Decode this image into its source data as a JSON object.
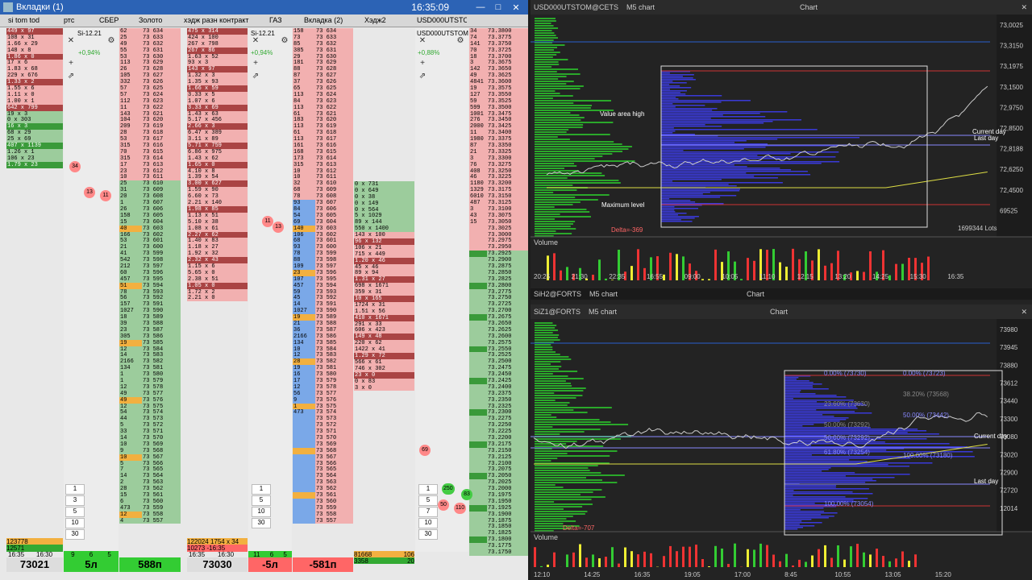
{
  "window": {
    "title": "Вкладки (1)",
    "clock": "16:35:09",
    "buttons": [
      "—",
      "□",
      "✕"
    ]
  },
  "tabs": [
    "si tom tod",
    "ртс",
    "СБЕР",
    "Золото",
    "хэдж разн контракт",
    "ГАЗ",
    "Вкладка (2)",
    "Хэдж2",
    "USD000UTSTOM"
  ],
  "ladders": {
    "col1_sizes": [
      "449 x 97",
      "108 x 31",
      "1.66 x 29",
      "148 x 8",
      "1.86 x 0",
      "17 x 6",
      "1.83 x 68",
      "229 x 676",
      "1.33 x 2",
      "1.55 x 6",
      "1.11 x 0",
      "1.00 x 1",
      "642 x 799",
      "19 x 3",
      "0 x 303",
      "16 x 3",
      "68 x 29",
      "25 x 69",
      "407 x 1139",
      "1.26 x 1",
      "106 x 23",
      "1.79 x 23"
    ],
    "col2_prices": [
      "73 634",
      "73 633",
      "73 632",
      "73 631",
      "73 630",
      "73 629",
      "73 628",
      "73 627",
      "73 626",
      "73 625",
      "73 624",
      "73 623",
      "73 622",
      "73 621",
      "73 620",
      "73 619",
      "73 618",
      "73 617",
      "73 616",
      "73 615",
      "73 614",
      "73 613",
      "73 612",
      "73 611",
      "73 610",
      "73 609",
      "73 608",
      "73 607",
      "73 606",
      "73 605",
      "73 604",
      "73 603",
      "73 602",
      "73 601",
      "73 600",
      "73 599",
      "73 598",
      "73 597",
      "73 596",
      "73 595",
      "73 594",
      "73 593",
      "73 592",
      "73 591",
      "73 590",
      "73 589",
      "73 588",
      "73 587",
      "73 586",
      "73 585",
      "73 584",
      "73 583",
      "73 582",
      "73 581",
      "73 580",
      "73 579",
      "73 578",
      "73 577",
      "73 576",
      "73 575",
      "73 574",
      "73 573",
      "73 572",
      "73 571",
      "73 570",
      "73 569",
      "73 568",
      "73 567",
      "73 566",
      "73 565",
      "73 564",
      "73 563",
      "73 562",
      "73 561",
      "73 560",
      "73 559",
      "73 558",
      "73 557"
    ],
    "col2_sizes": [
      "62",
      "25",
      "49",
      "55",
      "53",
      "113",
      "26",
      "105",
      "332",
      "57",
      "57",
      "112",
      "11",
      "143",
      "104",
      "209",
      "28",
      "53",
      "315",
      "70",
      "315",
      "17",
      "23",
      "10",
      "25",
      "31",
      "20",
      "1",
      "26",
      "158",
      "15",
      "40",
      "166",
      "53",
      "21",
      "41",
      "542",
      "212",
      "60",
      "457",
      "51",
      "78",
      "56",
      "157",
      "1027",
      "18",
      "39",
      "23",
      "305",
      "19",
      "12",
      "14",
      "2166",
      "134",
      "1",
      "1",
      "12",
      "49",
      "49",
      "12",
      "54",
      "44",
      "5",
      "33",
      "14",
      "10",
      "9",
      "10",
      "5",
      "7",
      "14",
      "2",
      "28",
      "15",
      "6",
      "473",
      "12",
      "4"
    ],
    "col3_sizes": [
      "475 x 314",
      "424 x 100",
      "267 x 798",
      "267 x 86",
      "1.63 x 52",
      "93 x 3",
      "143 x 97",
      "1.32 x 3",
      "1.35 x 93",
      "1.66 x 59",
      "3.33 x 5",
      "1.07 x 6",
      "3.33 x 69",
      "1.43 x 63",
      "5.17 x 456",
      "2.66 x 3",
      "6.47 x 389",
      "3.11 x 89",
      "5.71 x 759",
      "6.86 x 975",
      "1.43 x 62",
      "1.65 x 0",
      "4.10 x 8",
      "1.39 x 54",
      "3.00 x 627",
      "1.59 x 90",
      "6.60 x 73",
      "2.21 x 140",
      "1.98 x 85",
      "1.13 x 51",
      "5.10 x 38",
      "1.08 x 61",
      "2.27 x 62",
      "1.40 x 83",
      "1.18 x 27",
      "1.92 x 32",
      "2.32 x 43",
      "1.15 x 6",
      "5.65 x 0",
      "2.38 x 51",
      "1.05 x 0",
      "1.72 x 2",
      "2.21 x 0"
    ],
    "col4_sizes": [
      "158",
      "73",
      "85",
      "385",
      "29",
      "181",
      "88",
      "87",
      "37",
      "65",
      "113",
      "84",
      "113",
      "61",
      "183",
      "113",
      "61",
      "113",
      "161",
      "168",
      "173",
      "315",
      "10",
      "10",
      "32",
      "68",
      "78",
      "93",
      "84",
      "54",
      "69",
      "140",
      "106",
      "68",
      "93",
      "78",
      "88",
      "109",
      "23",
      "107",
      "457",
      "59",
      "45",
      "14",
      "1027",
      "19",
      "21",
      "36",
      "2166",
      "134",
      "10",
      "12",
      "28",
      "19",
      "16",
      "17",
      "12",
      "56",
      "9",
      "1",
      "473"
    ],
    "col5_sizes": [
      "0 x 731",
      "0 x 649",
      "0 x 38",
      "0 x 149",
      "0 x 564",
      "5 x 1029",
      "89 x 144",
      "550 x 1400",
      "143 x 100",
      "96 x 132",
      "106 x 21",
      "715 x 449",
      "1.20 x 46",
      "45 x 46",
      "89 x 94",
      "1.31 x 27",
      "698 x 1671",
      "359 x 31",
      "10 x 165",
      "1724 x 31",
      "1.51 x 56",
      "410 x 1671",
      "291 x 33",
      "606 x 423",
      "149 x 48",
      "220 x 62",
      "1422 x 41",
      "1.29 x 72",
      "566 x 61",
      "746 x 302",
      "23 x 0",
      "0 x 83",
      "3 x 0"
    ],
    "col6_sizes": [
      "34",
      "74",
      "141",
      "70",
      "18",
      "3",
      "142",
      "49",
      "4841",
      "19",
      "127",
      "59",
      "599",
      "1001",
      "276",
      "2000",
      "11",
      "1980",
      "87",
      "21",
      "3",
      "76",
      "408",
      "46",
      "1180",
      "1329",
      "6010",
      "487",
      "3",
      "43",
      "15"
    ],
    "col6_prices": [
      "73.3800",
      "73.3775",
      "73.3750",
      "73.3725",
      "73.3700",
      "73.3675",
      "73.3650",
      "73.3625",
      "73.3600",
      "73.3575",
      "73.3550",
      "73.3525",
      "73.3500",
      "73.3475",
      "73.3450",
      "73.3425",
      "73.3400",
      "73.3375",
      "73.3350",
      "73.3325",
      "73.3300",
      "73.3275",
      "73.3250",
      "73.3225",
      "73.3200",
      "73.3175",
      "73.3150",
      "73.3125",
      "73.3100",
      "73.3075",
      "73.3050",
      "73.3025",
      "73.3000",
      "73.2975",
      "73.2950",
      "73.2925",
      "73.2900",
      "73.2875",
      "73.2850",
      "73.2825",
      "73.2800",
      "73.2775",
      "73.2750",
      "73.2725",
      "73.2700",
      "73.2675",
      "73.2650",
      "73.2625",
      "73.2600",
      "73.2575",
      "73.2550",
      "73.2525",
      "73.2500",
      "73.2475",
      "73.2450",
      "73.2425",
      "73.2400",
      "73.2375",
      "73.2350",
      "73.2325",
      "73.2300",
      "73.2275",
      "73.2250",
      "73.2225",
      "73.2200",
      "73.2175",
      "73.2150",
      "73.2125",
      "73.2100",
      "73.2075",
      "73.2050",
      "73.2025",
      "73.2000",
      "73.1975",
      "73.1950",
      "73.1925",
      "73.1900",
      "73.1875",
      "73.1850",
      "73.1825",
      "73.1800",
      "73.1775",
      "73.1750"
    ]
  },
  "side_panels": {
    "p1": {
      "name": "Si-12.21",
      "change": "+0,94%",
      "steps": [
        "1",
        "3",
        "5",
        "10",
        "30"
      ]
    },
    "p2": {
      "name": "Si-12.21",
      "change": "+0,94%",
      "steps": [
        "1",
        "5",
        "10",
        "30"
      ]
    },
    "p3": {
      "name": "USD000UTSTOM",
      "change": "+0,88%",
      "steps": [
        "1",
        "5",
        "7",
        "10",
        "30"
      ]
    }
  },
  "bubbles": [
    "34",
    "13",
    "11",
    "13",
    "11",
    "69",
    "250",
    "83",
    "50",
    "110"
  ],
  "footers": {
    "f1": {
      "small_a": "123778",
      "small_b": "12571",
      "time": "16:35",
      "time2": "16:30",
      "val": "73021",
      "g": [
        "9",
        "6",
        "5"
      ]
    },
    "f2": {
      "val": "5л"
    },
    "f3": {
      "val": "588п"
    },
    "f4": {
      "small_a": "122024",
      "small_b": "10273",
      "time": "16:35",
      "time2": "16:30",
      "extra": "1754 x 34",
      "extra2": "-16:35",
      "val": "73030"
    },
    "f5": {
      "g": [
        "11",
        "6",
        "5"
      ],
      "val": "-5л"
    },
    "f6": {
      "val": "-581п"
    },
    "f7": {
      "a": "81668",
      "b": "3358",
      "c": "106",
      "d": "20",
      "val": ""
    }
  },
  "chart1": {
    "header": [
      "USD000UTSTOM@CETS",
      "M5 chart",
      "Chart"
    ],
    "labels": {
      "vah": "Value area high",
      "maxlvl": "Maximum level",
      "vol": "Volume",
      "cur": "Current day",
      "last": "Last day",
      "lots": "1699344 Lots",
      "stat": "Delta=-369"
    },
    "prices": [
      "73,0025",
      "73,3150",
      "73,1975",
      "73,1500",
      "72,9750",
      "72,8500",
      "72,8188",
      "72,6250",
      "72,4500",
      "69525"
    ],
    "times": [
      "20:25",
      "21:30",
      "22:35",
      "16:55",
      "09:00",
      "10:05",
      "11:10",
      "12:15",
      "13:20",
      "14:25",
      "15:30",
      "16:35"
    ]
  },
  "chart2": {
    "header": [
      "SiZ1@FORTS",
      "M5 chart",
      "Chart"
    ],
    "header_top": [
      "SiH2@FORTS",
      "M5 chart",
      "Chart"
    ],
    "labels": {
      "vol": "Volume",
      "cur": "Current day",
      "last": "Last day",
      "stat": "Delta=-707"
    },
    "fibs": [
      "0.00% (73730)",
      "0.00% (73723)",
      "23.60% (73630)",
      "38.20% (73568)",
      "50.00% (73442)",
      "61.80% (73480)",
      "50.00% (73292)",
      "61.80% (73254)",
      "100.00% (73180)",
      "100.00% (73054)"
    ],
    "prices": [
      "73980",
      "73945",
      "73880",
      "73612",
      "73440",
      "73300",
      "73080",
      "73020",
      "72900",
      "72720",
      "12014"
    ],
    "times": [
      "12:10",
      "14:25",
      "16:35",
      "19:05",
      "17:00",
      "8:45",
      "10:55",
      "13:05",
      "15:20"
    ]
  },
  "colors": {
    "title": "#2c63b5",
    "sell": "#f2b0b0",
    "buy": "#9ccc9c",
    "chart_bg": "#232323",
    "profile": "#3a3ad8",
    "green_profile": "#2aa82a"
  }
}
